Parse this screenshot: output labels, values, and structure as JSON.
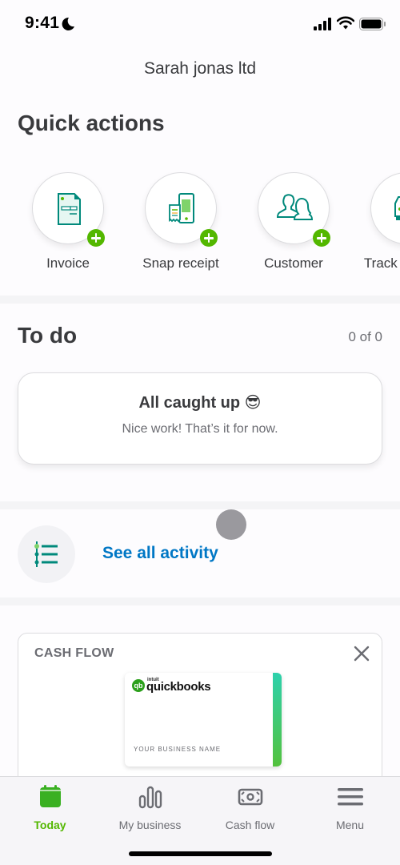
{
  "status_bar": {
    "time": "9:41",
    "icons": [
      "moon-icon",
      "signal-icon",
      "wifi-icon",
      "battery-icon"
    ]
  },
  "header": {
    "company_name": "Sarah jonas ltd"
  },
  "quick_actions": {
    "title": "Quick actions",
    "items": [
      {
        "label": "Invoice",
        "icon": "invoice-icon"
      },
      {
        "label": "Snap receipt",
        "icon": "snap-receipt-icon"
      },
      {
        "label": "Customer",
        "icon": "customer-icon"
      },
      {
        "label": "Track mileage",
        "icon": "car-icon"
      }
    ]
  },
  "todo": {
    "title": "To do",
    "count": "0 of 0",
    "card_title": "All caught up 😎",
    "card_subtitle": "Nice work! That’s it for now."
  },
  "activity": {
    "link_label": "See all activity",
    "icon": "activity-list-icon"
  },
  "cash_flow": {
    "title": "CASH FLOW",
    "card_brand_small": "intuit",
    "card_brand": "quickbooks",
    "card_business_name": "YOUR BUSINESS NAME"
  },
  "tabbar": {
    "active": "Today",
    "tabs": [
      {
        "label": "Today",
        "icon": "calendar-icon"
      },
      {
        "label": "My business",
        "icon": "bar-chart-icon"
      },
      {
        "label": "Cash flow",
        "icon": "money-icon"
      },
      {
        "label": "Menu",
        "icon": "hamburger-icon"
      }
    ]
  },
  "colors": {
    "brand_green": "#53b700",
    "link_blue": "#0077c5",
    "icon_teal": "#00897b",
    "text_dark": "#393a3d"
  }
}
